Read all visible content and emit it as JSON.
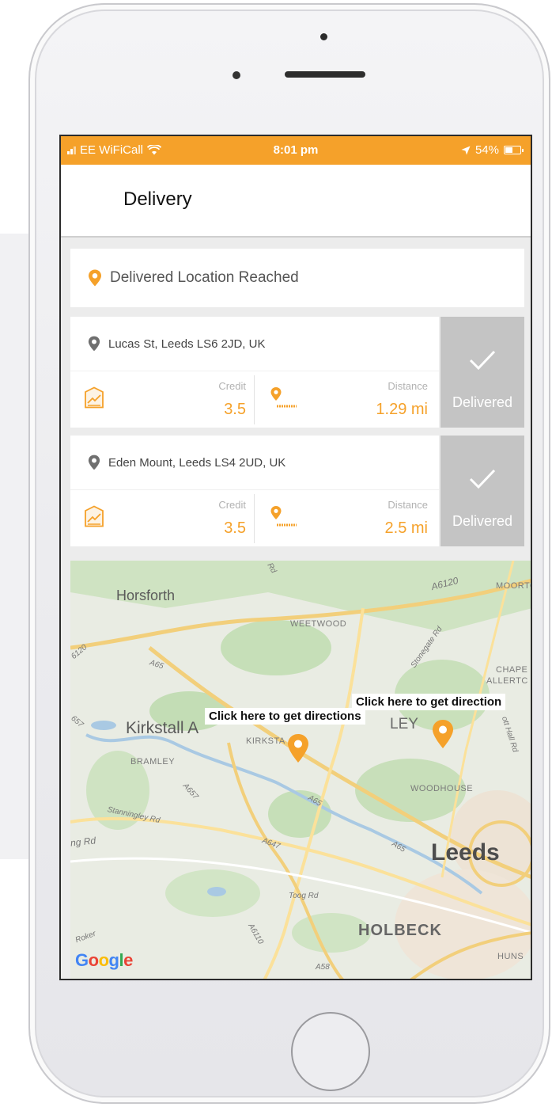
{
  "status_bar": {
    "carrier": "EE WiFiCall",
    "time": "8:01 pm",
    "battery": "54%",
    "battery_level": 0.54
  },
  "header": {
    "title": "Delivery"
  },
  "banner": {
    "text": "Delivered Location Reached"
  },
  "deliveries": [
    {
      "address": "Lucas St, Leeds LS6 2JD, UK",
      "credit_label": "Credit",
      "credit": "3.5",
      "distance_label": "Distance",
      "distance": "1.29 mi",
      "action_label": "Delivered"
    },
    {
      "address": "Eden Mount, Leeds LS4 2UD, UK",
      "credit_label": "Credit",
      "credit": "3.5",
      "distance_label": "Distance",
      "distance": "2.5 mi",
      "action_label": "Delivered"
    }
  ],
  "map": {
    "callouts": [
      "Click here to get directions",
      "Click here to get direction"
    ],
    "places": {
      "horsforth": "Horsforth",
      "weetwood": "WEETWOOD",
      "kirkstall": "Kirkstall A",
      "kirkstall_small": "KIRKSTA",
      "bramley": "BRAMLEY",
      "woodhouse": "WOODHOUSE",
      "leeds": "Leeds",
      "holbeck": "HOLBECK",
      "headingley": "LEY",
      "moortown": "MOORTO",
      "chapel": "CHAPE",
      "allerton": "ALLERTC",
      "huns": "HUNS"
    },
    "roads": {
      "a6120_top": "A6120",
      "a65_left": "A65",
      "a6120_left": "6120",
      "stonegate": "Stonegate Rd",
      "a657": "A657",
      "stanningley": "Stanningley Rd",
      "ng_rd": "ng Rd",
      "a647": "A647",
      "a65_mid": "A65",
      "a65_right": "A65",
      "toog": "Toog Rd",
      "a6110": "A6110",
      "a58": "A58",
      "hall_rd": "ott Hall Rd",
      "rd_top": "Rd",
      "roker": "Roker",
      "a657_left": "657"
    },
    "attribution": "Google"
  },
  "colors": {
    "accent": "#f5a12a",
    "action_bg": "#c4c4c4",
    "marker_dark": "#6f6f6f"
  },
  "icons": [
    "signal-icon",
    "wifi-icon",
    "location-arrow-icon",
    "battery-icon",
    "pin-icon",
    "chart-card-icon",
    "distance-pin-icon",
    "checkmark-icon",
    "map-marker-icon"
  ]
}
